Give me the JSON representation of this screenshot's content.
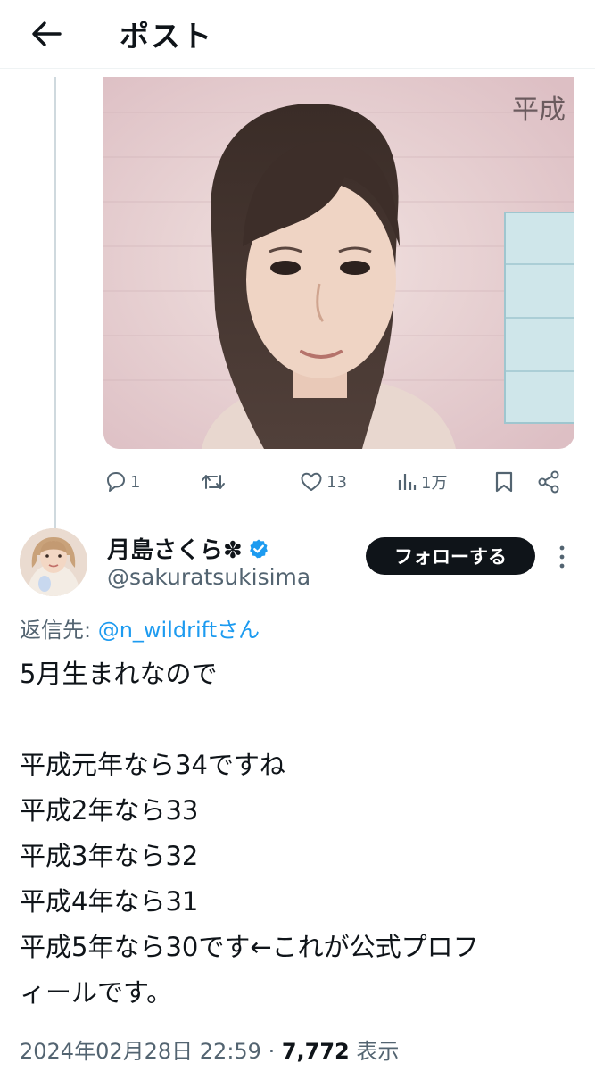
{
  "header": {
    "title": "ポスト"
  },
  "parent_post": {
    "photo_caption": "平成",
    "actions": {
      "reply_count": "1",
      "repost_count": "",
      "like_count": "13",
      "view_count": "1万"
    }
  },
  "post": {
    "author": {
      "name": "月島さくら✽",
      "handle": "@sakuratsukisima",
      "verified": true
    },
    "follow_label": "フォローする",
    "reply_to": {
      "prefix": "返信先: ",
      "mention": "@n_wildrift",
      "suffix": "さん"
    },
    "text_lines": [
      "5月生まれなので",
      "",
      "平成元年なら34ですね",
      "平成2年なら33",
      "平成3年なら32",
      "平成4年なら31",
      "平成5年なら30です←これが公式プロフ",
      "ィールです。"
    ],
    "meta": {
      "timestamp": "2024年02月28日 22:59",
      "separator": " · ",
      "views": "7,772",
      "views_label": " 表示"
    }
  },
  "colors": {
    "accent": "#1d9bf0",
    "text": "#0f1419",
    "secondary": "#536471",
    "follow_bg": "#0f1419"
  }
}
